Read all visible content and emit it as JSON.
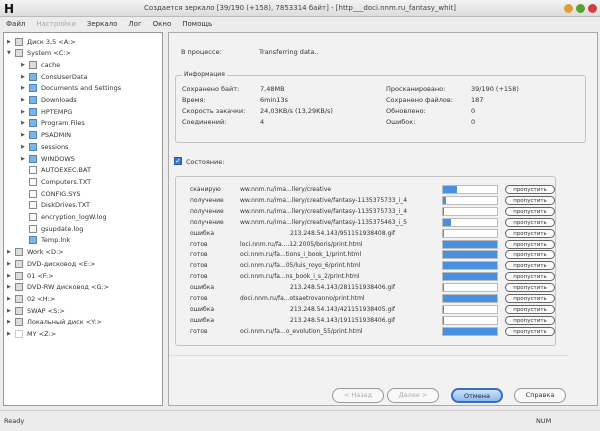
{
  "window": {
    "logo": "H",
    "title": "Создается зеркало [39/190 (+158), 7853314 байт] - [http___doci.nnm.ru_fantasy_whit]",
    "colors": {
      "min": "#e0a030",
      "max": "#5aa030",
      "close": "#d04040"
    }
  },
  "menu": [
    "Файл",
    "Настройки",
    "Зеркало",
    "Лог",
    "Окно",
    "Помощь"
  ],
  "tree": [
    {
      "label": "Диск 3,5 <A:>",
      "level": 0,
      "icon": "floppy",
      "arrow": "▶"
    },
    {
      "label": "System <C:>",
      "level": 0,
      "icon": "drive",
      "arrow": "▼"
    },
    {
      "label": "cache",
      "level": 1,
      "icon": "drive",
      "arrow": "▶"
    },
    {
      "label": "ConsUserData",
      "level": 1,
      "icon": "folder",
      "arrow": "▶"
    },
    {
      "label": "Documents and Settings",
      "level": 1,
      "icon": "folder",
      "arrow": "▶"
    },
    {
      "label": "Downloads",
      "level": 1,
      "icon": "folder",
      "arrow": "▶"
    },
    {
      "label": "HPTEMPG",
      "level": 1,
      "icon": "folder",
      "arrow": "▶"
    },
    {
      "label": "Program Files",
      "level": 1,
      "icon": "folder",
      "arrow": "▶"
    },
    {
      "label": "PSADMIN",
      "level": 1,
      "icon": "folder",
      "arrow": "▶"
    },
    {
      "label": "sessions",
      "level": 1,
      "icon": "folder",
      "arrow": "▶"
    },
    {
      "label": "WINDOWS",
      "level": 1,
      "icon": "folder",
      "arrow": "▶"
    },
    {
      "label": "AUTOEXEC.BAT",
      "level": 1,
      "icon": "file",
      "arrow": ""
    },
    {
      "label": "Computers.TXT",
      "level": 1,
      "icon": "file",
      "arrow": ""
    },
    {
      "label": "CONFIG.SYS",
      "level": 1,
      "icon": "file",
      "arrow": ""
    },
    {
      "label": "DiskDrives.TXT",
      "level": 1,
      "icon": "file",
      "arrow": ""
    },
    {
      "label": "encryption_logW.log",
      "level": 1,
      "icon": "file",
      "arrow": ""
    },
    {
      "label": "gsupdate.log",
      "level": 1,
      "icon": "file",
      "arrow": ""
    },
    {
      "label": "Temp.lnk",
      "level": 1,
      "icon": "folder",
      "arrow": ""
    },
    {
      "label": "Work <D:>",
      "level": 0,
      "icon": "drive",
      "arrow": "▶"
    },
    {
      "label": "DVD-дисковод <E:>",
      "level": 0,
      "icon": "drive",
      "arrow": "▶"
    },
    {
      "label": "01 <F:>",
      "level": 0,
      "icon": "drive",
      "arrow": "▶"
    },
    {
      "label": "DVD-RW дисковод <G:>",
      "level": 0,
      "icon": "drive",
      "arrow": "▶"
    },
    {
      "label": "02 <H:>",
      "level": 0,
      "icon": "drive",
      "arrow": "▶"
    },
    {
      "label": "SWAP <S:>",
      "level": 0,
      "icon": "drive",
      "arrow": "▶"
    },
    {
      "label": "Локальный диск <Y:>",
      "level": 0,
      "icon": "drive",
      "arrow": "▶"
    },
    {
      "label": "MY <Z:>",
      "level": 0,
      "icon": "none",
      "arrow": "▶"
    }
  ],
  "progress": {
    "label": "В процессе:",
    "value": "Transferring data.."
  },
  "info": {
    "legend": "Информация",
    "left": [
      {
        "k": "Сохранено байт:",
        "v": "7,48MB"
      },
      {
        "k": "Время:",
        "v": "6min13s"
      },
      {
        "k": "Скорость закачки:",
        "v": "24,03KB/s (13,29KB/s)"
      },
      {
        "k": "Соединений:",
        "v": "4"
      }
    ],
    "right": [
      {
        "k": "Просканировано:",
        "v": "39/190 (+158)"
      },
      {
        "k": "Сохранено файлов:",
        "v": "187"
      },
      {
        "k": "Обновлено:",
        "v": "0"
      },
      {
        "k": "Ошибок:",
        "v": "0"
      }
    ]
  },
  "status": {
    "label": "Состояние:",
    "checked": true,
    "skip_label": "пропустить",
    "rows": [
      {
        "state": "сканирую",
        "url": "ww.nnm.ru/ima...llery/creative",
        "progress": 25,
        "center": false
      },
      {
        "state": "получение",
        "url": "ww.nnm.ru/ima...llery/creative/fantasy-1135375733_i_4",
        "progress": 5,
        "center": false
      },
      {
        "state": "получение",
        "url": "ww.nnm.ru/ima...llery/creative/fantasy-1135375733_i_4",
        "progress": 2,
        "center": false
      },
      {
        "state": "получение",
        "url": "ww.nnm.ru/ima...llery/creative/fantasy-1135375463_i_5",
        "progress": 15,
        "center": false
      },
      {
        "state": "ошибка",
        "url": "213.248.54.143/951151938408.gif",
        "progress": 1,
        "center": true
      },
      {
        "state": "готов",
        "url": "loci.nnm.ru/fa....12.2005/boris/print.html",
        "progress": 100,
        "center": false
      },
      {
        "state": "готов",
        "url": "oci.nnm.ru/fa...tions_i_book_1/print.html",
        "progress": 100,
        "center": false
      },
      {
        "state": "готов",
        "url": "oci.nnm.ru/fa...05/luis_royo_6/print.html",
        "progress": 100,
        "center": false
      },
      {
        "state": "готов",
        "url": "oci.nnm.ru/fa...ns_book_i_s_2/print.html",
        "progress": 100,
        "center": false
      },
      {
        "state": "ошибка",
        "url": "213.248.54.143/281151938406.gif",
        "progress": 1,
        "center": true
      },
      {
        "state": "готов",
        "url": "doci.nnm.ru/fa...otsaetrovanno/print.html",
        "progress": 100,
        "center": false
      },
      {
        "state": "ошибка",
        "url": "213.248.54.143/421151938405.gif",
        "progress": 1,
        "center": true
      },
      {
        "state": "ошибка",
        "url": "213.248.54.143/191151938406.gif",
        "progress": 1,
        "center": true
      },
      {
        "state": "готов",
        "url": "oci.nnm.ru/fa...o_evolution_55/print.html",
        "progress": 100,
        "center": false
      }
    ]
  },
  "buttons": {
    "back": "< Назад",
    "next": "Далее >",
    "cancel": "Отмена",
    "help": "Справка"
  },
  "statusbar": {
    "ready": "Ready",
    "num": "NUM"
  }
}
